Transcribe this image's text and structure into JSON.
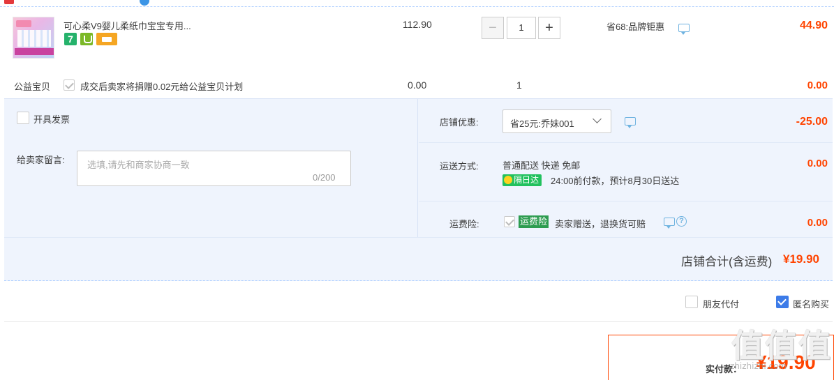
{
  "item": {
    "title": "可心柔V9婴儿柔纸巾宝宝专用...",
    "unit_price": "112.90",
    "quantity": "1",
    "discount_note": "省68:品牌钜惠",
    "total": "44.90",
    "badge_7": "7"
  },
  "charity": {
    "label": "公益宝贝",
    "text": "成交后卖家将捐赠0.02元给公益宝贝计划",
    "price": "0.00",
    "qty": "1",
    "total": "0.00"
  },
  "invoice": {
    "label": "开具发票",
    "checked": false
  },
  "message": {
    "label": "给卖家留言:",
    "placeholder": "选填,请先和商家协商一致",
    "counter": "0/200"
  },
  "coupon": {
    "label": "店铺优惠:",
    "selected": "省25元:乔妹001",
    "amount": "-25.00"
  },
  "shipping": {
    "label": "运送方式:",
    "method": "普通配送 快递 免邮",
    "badge": "隔日达",
    "eta": "24:00前付款，预计8月30日送达",
    "amount": "0.00"
  },
  "insurance": {
    "label": "运费险:",
    "tag": "运费险",
    "text": "卖家赠送，退换货可赔",
    "help": "?",
    "amount": "0.00"
  },
  "subtotal": {
    "label": "店铺合计(含运费)",
    "amount": "¥19.90"
  },
  "options": {
    "friend_pay": {
      "label": "朋友代付",
      "checked": false
    },
    "anonymous": {
      "label": "匿名购买",
      "checked": true
    }
  },
  "payment": {
    "label": "实付款：",
    "amount": "¥19.90"
  },
  "stepper": {
    "minus": "−",
    "plus": "+"
  },
  "watermark": {
    "text": "值值值",
    "sub": "zhizhizhi.com"
  },
  "colors": {
    "accent": "#ff4400",
    "panel": "#eff4fd",
    "check_blue": "#3c7be8",
    "green": "#22c15e"
  }
}
